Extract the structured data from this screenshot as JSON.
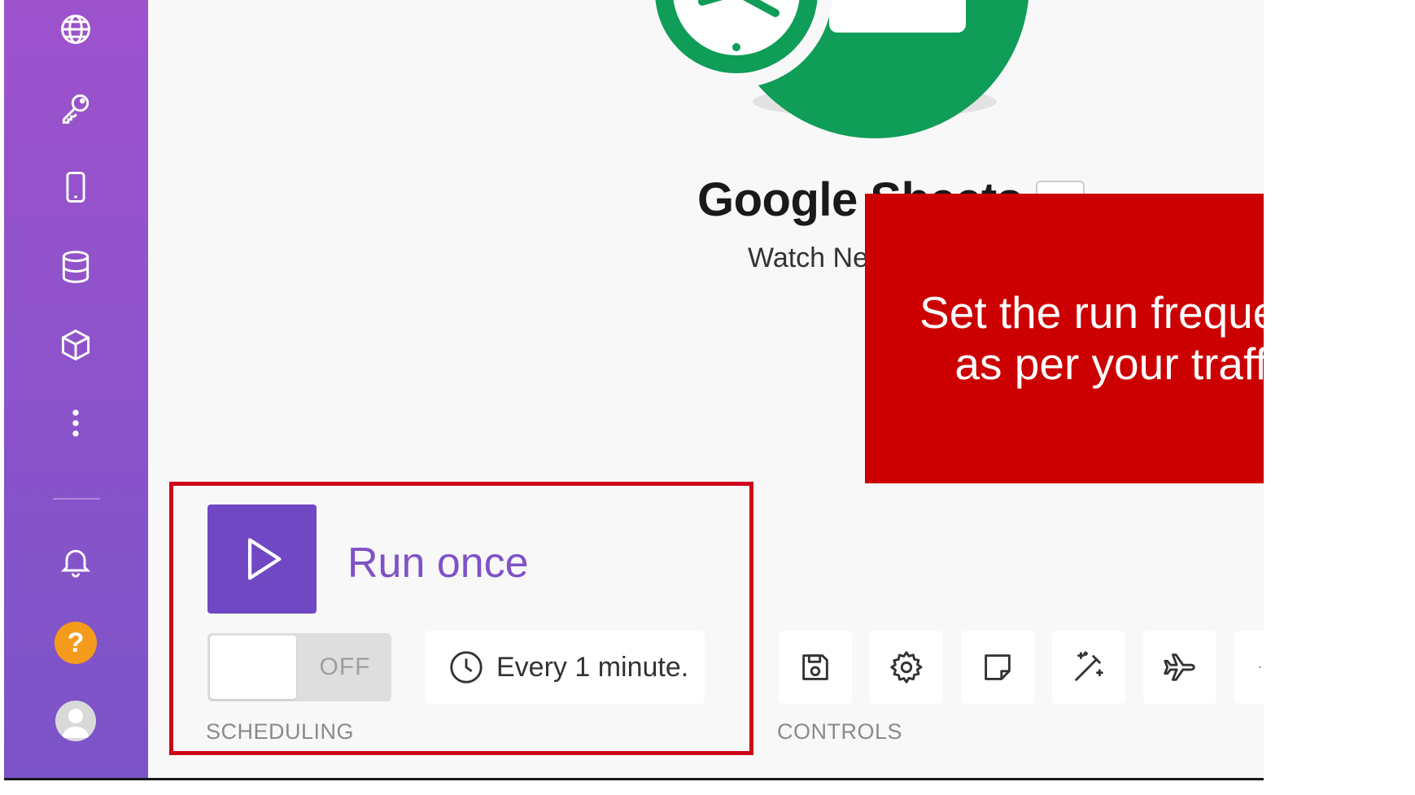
{
  "sidebar": {
    "items": [
      {
        "icon": "globe-icon"
      },
      {
        "icon": "key-icon"
      },
      {
        "icon": "mobile-device-icon"
      },
      {
        "icon": "database-icon"
      },
      {
        "icon": "cube-icon"
      },
      {
        "icon": "more-vertical-icon"
      }
    ],
    "bottom": [
      {
        "icon": "bell-icon"
      },
      {
        "icon": "help-icon",
        "label": "?"
      },
      {
        "icon": "user-avatar-icon"
      }
    ],
    "gradient_top": "#9d52cc",
    "gradient_bottom": "#7b54c8"
  },
  "module": {
    "title": "Google Sheets",
    "subtitle": "Watch Ne",
    "brand_color": "#0f9d58"
  },
  "callout": {
    "line1": "Set the run frequency",
    "line2": "as per your traffic.",
    "color": "#cc0000"
  },
  "scheduling": {
    "run_label": "Run once",
    "toggle_state": "OFF",
    "schedule_text": "Every 1 minute.",
    "section_label": "SCHEDULING",
    "accent": "#7048c4"
  },
  "controls": {
    "section_label": "CONTROLS",
    "items": [
      {
        "icon": "save-icon"
      },
      {
        "icon": "gear-icon"
      },
      {
        "icon": "note-icon"
      },
      {
        "icon": "magic-wand-icon"
      },
      {
        "icon": "airplane-icon"
      },
      {
        "icon": "more-icon"
      }
    ]
  }
}
